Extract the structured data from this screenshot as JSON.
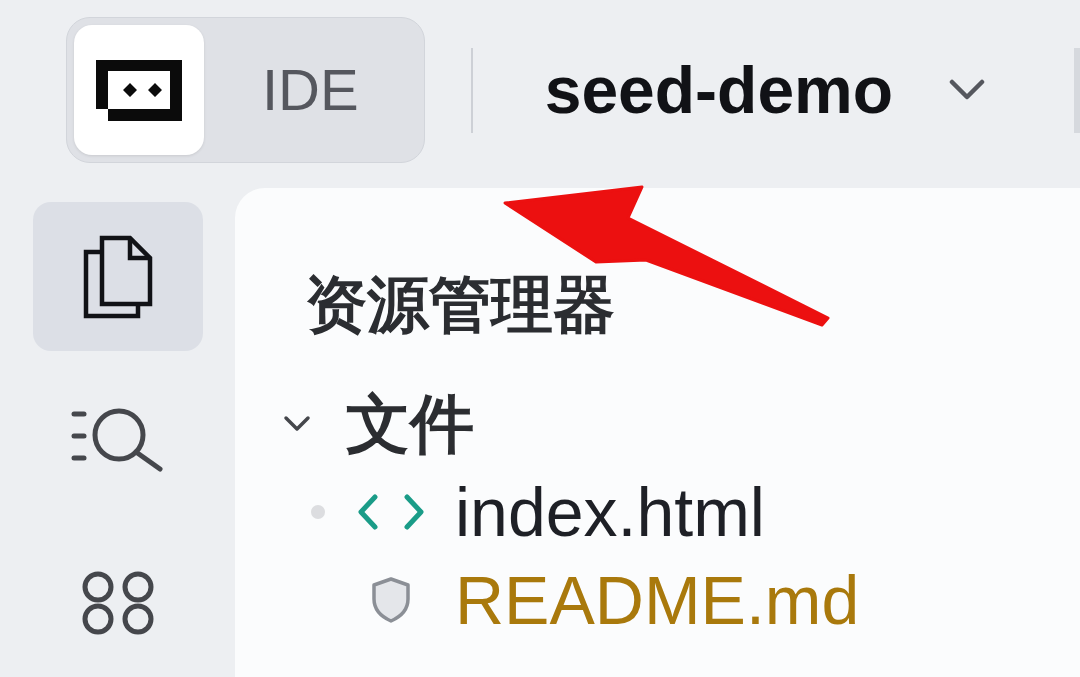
{
  "header": {
    "mode_switch": [
      {
        "kind": "logo",
        "selected": true
      },
      {
        "kind": "label",
        "text": "IDE",
        "selected": false
      }
    ],
    "project": {
      "name": "seed-demo"
    }
  },
  "activity_bar": {
    "items": [
      {
        "kind": "files",
        "selected": true
      },
      {
        "kind": "search",
        "selected": false
      },
      {
        "kind": "extensions",
        "selected": false
      }
    ]
  },
  "explorer": {
    "title": "资源管理器",
    "tree": [
      {
        "label": "文件",
        "kind": "folder",
        "expanded": true,
        "children": [
          {
            "label": "index.html",
            "kind": "html",
            "open": true,
            "color": "#1e2026"
          },
          {
            "label": "README.md",
            "kind": "markdown",
            "open": false,
            "color": "#a9790c"
          }
        ]
      }
    ]
  },
  "annotations": [
    {
      "kind": "arrow"
    }
  ]
}
